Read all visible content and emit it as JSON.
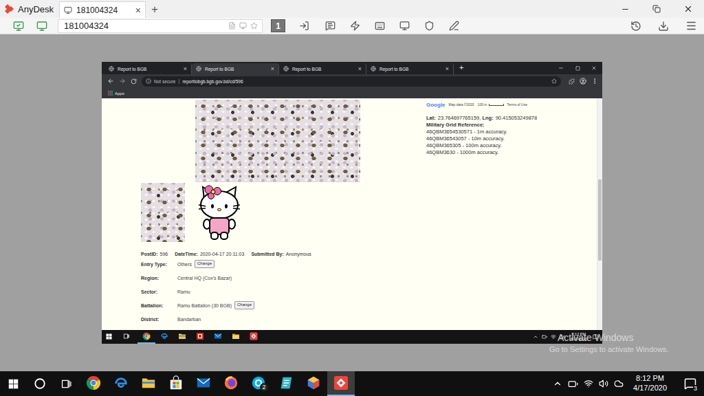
{
  "anydesk": {
    "app_name": "AnyDesk",
    "tabs": [
      {
        "label": "181004324",
        "close": "×",
        "selected": true
      }
    ],
    "new_tab": "+",
    "address": "181004324",
    "display_number": "1"
  },
  "remote": {
    "browser": {
      "tabs": [
        {
          "label": "Report to BGB",
          "close": "×",
          "selected": false
        },
        {
          "label": "Report to BGB",
          "close": "×",
          "selected": true
        },
        {
          "label": "Report to BGB",
          "close": "×",
          "selected": false
        },
        {
          "label": "Report to BGB",
          "close": "×",
          "selected": false
        }
      ],
      "new_tab": "+",
      "security": "Not secure",
      "url": "reporttobgb.bgb.gov.bd/cd/596",
      "bookmarks": [
        "Apps"
      ]
    },
    "page": {
      "map": {
        "logo": "Google",
        "attribution": "Map data ©2020",
        "scale": "100 m",
        "terms": "Terms of Use"
      },
      "location": [
        {
          "label": "Lat:",
          "value": "23.764697765159,"
        },
        {
          "label": "Lng:",
          "value": "90.415053249878"
        }
      ],
      "grid": {
        "title": "Military Grid Reference:",
        "lines": [
          "46QBM3654530571 - 1m accuracy.",
          "46QBM36543057 - 10m accuracy.",
          "46QBM365305 - 100m accuracy.",
          "46QBM3630 - 1000m accuracy."
        ]
      },
      "meta": [
        {
          "label": "PostID:",
          "value": "596"
        },
        {
          "label": "DateTime:",
          "value": "2020-04-17 20:11:03"
        },
        {
          "label": "Submitted By:",
          "value": "Anonymous"
        }
      ],
      "details": [
        {
          "label": "Entry Type:",
          "value": "Others",
          "action": "Change"
        },
        {
          "label": "Region:",
          "value": "Central HQ (Cox's Bazar)"
        },
        {
          "label": "Sector:",
          "value": "Ramu"
        },
        {
          "label": "Battalion:",
          "value": "Ramu Battalion (30 BGB)",
          "action": "Change"
        },
        {
          "label": "District:",
          "value": "Bandarban"
        }
      ],
      "scrollbar": {
        "offset": 0.35,
        "thumb": 0.35
      }
    },
    "taskbar": {
      "apps": [
        {
          "kind": "chrome",
          "active": true
        },
        {
          "kind": "edge",
          "active": false
        },
        {
          "kind": "explorer",
          "active": false
        },
        {
          "kind": "security",
          "active": false
        },
        {
          "kind": "mail",
          "active": false
        },
        {
          "kind": "folder",
          "active": false
        },
        {
          "kind": "anydesk",
          "active": false
        }
      ],
      "time": "8:12 PM",
      "date": "4/17/2020"
    }
  },
  "watermark": {
    "title": "Activate Windows",
    "subtitle": "Go to Settings to activate Windows."
  },
  "taskbar": {
    "apps": [
      {
        "kind": "chrome",
        "active": false
      },
      {
        "kind": "edge",
        "active": false
      },
      {
        "kind": "explorer",
        "active": false
      },
      {
        "kind": "store",
        "active": false
      },
      {
        "kind": "mail",
        "active": false
      },
      {
        "kind": "firefox",
        "active": false
      },
      {
        "kind": "skype",
        "badge": "2",
        "active": false
      },
      {
        "kind": "notes",
        "active": false
      },
      {
        "kind": "hex",
        "active": false
      },
      {
        "kind": "anydesk",
        "active": true
      }
    ],
    "time": "8:12 PM",
    "date": "4/17/2020",
    "notifications": "3"
  }
}
